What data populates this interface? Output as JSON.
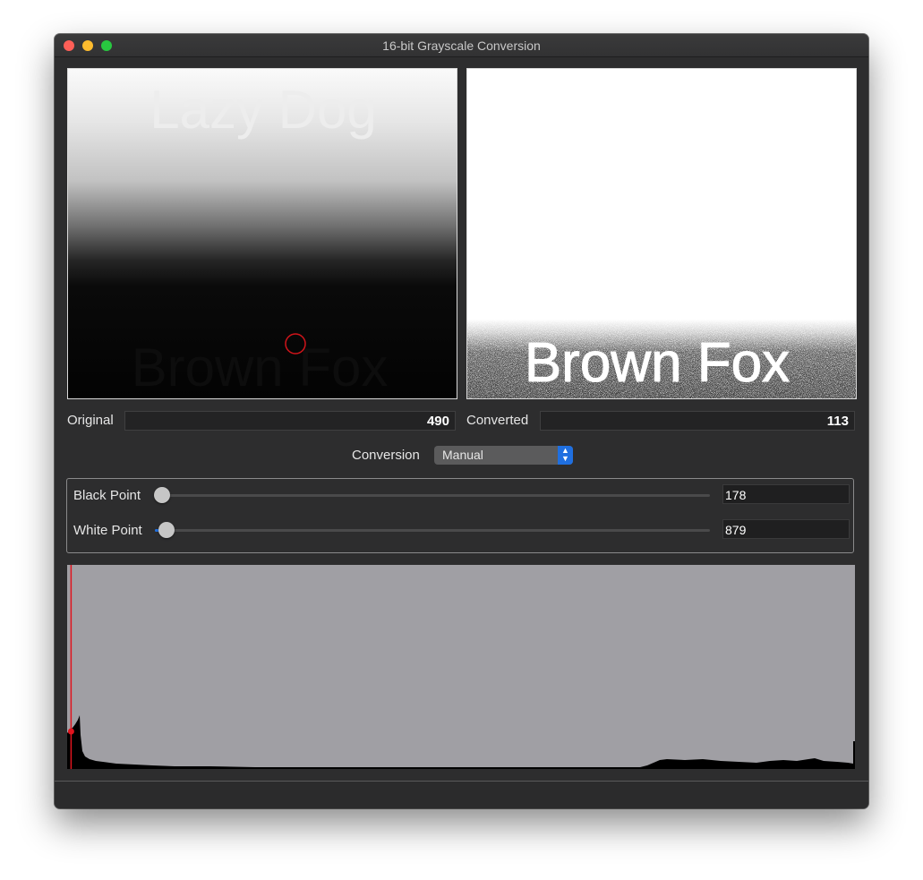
{
  "window": {
    "title": "16-bit Grayscale Conversion"
  },
  "images": {
    "original": {
      "top_text": "Lazy Dog",
      "bottom_text": "Brown Fox"
    },
    "converted": {
      "text": "Brown Fox"
    }
  },
  "readouts": {
    "original_label": "Original",
    "original_value": "490",
    "converted_label": "Converted",
    "converted_value": "113"
  },
  "conversion": {
    "label": "Conversion",
    "selected": "Manual"
  },
  "levels": {
    "black_point_label": "Black Point",
    "black_point_value": "178",
    "black_point_fraction": 0.0,
    "white_point_label": "White Point",
    "white_point_value": "879",
    "white_point_fraction": 0.015
  },
  "histogram": {
    "background_color": "#a09fa4",
    "bar_color": "#000000",
    "marker_color": "#e0141e",
    "marker_fraction": 0.005
  }
}
